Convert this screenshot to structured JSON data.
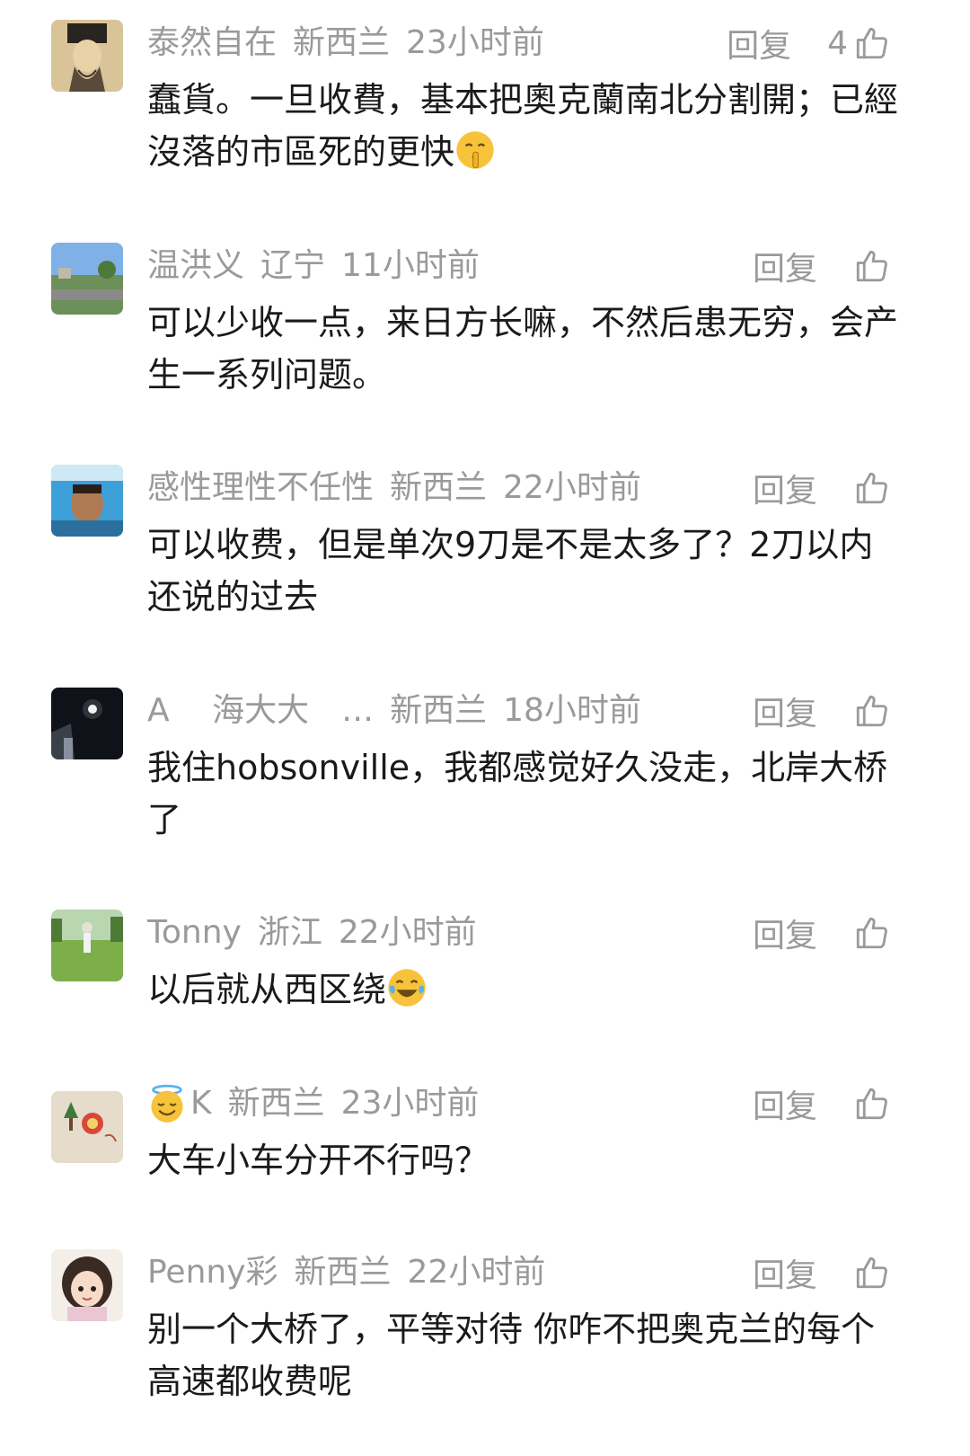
{
  "comments": [
    {
      "author": "泰然自在",
      "location": "新西兰",
      "time": "23小时前",
      "reply": "回复",
      "likes": "4",
      "text": "蠢貨。一旦收費，基本把奧克蘭南北分割開；已經沒落的市區死的更快",
      "emoji": "shushing-face"
    },
    {
      "author": "温洪义",
      "location": "辽宁",
      "time": "11小时前",
      "reply": "回复",
      "likes": "",
      "text": "可以少收一点，来日方长嘛，不然后患无穷，会产生一系列问题。"
    },
    {
      "author": "感性理性不任性",
      "location": "新西兰",
      "time": "22小时前",
      "reply": "回复",
      "likes": "",
      "text": "可以收费，但是单次9刀是不是太多了？2刀以内还说的过去"
    },
    {
      "author": "A　 海大大　…",
      "location": "新西兰",
      "time": "18小时前",
      "reply": "回复",
      "likes": "",
      "text": "我住hobsonville，我都感觉好久没走，北岸大桥了"
    },
    {
      "author": "Tonny",
      "location": "浙江",
      "time": "22小时前",
      "reply": "回复",
      "likes": "",
      "text": "以后就从西区绕",
      "emoji": "tears-of-joy"
    },
    {
      "author": "K",
      "location": "新西兰",
      "time": "23小时前",
      "reply": "回复",
      "likes": "",
      "author_emoji": "halo-face",
      "text": "大车小车分开不行吗？"
    },
    {
      "author": "Penny彩",
      "location": "新西兰",
      "time": "22小时前",
      "reply": "回复",
      "likes": "",
      "text": "别一个大桥了，平等对待 你咋不把奥克兰的每个高速都收费呢"
    }
  ],
  "icons": {
    "like": "thumbs-up-icon"
  },
  "colors": {
    "meta": "#9a9a9a",
    "text": "#1a1a1a"
  }
}
